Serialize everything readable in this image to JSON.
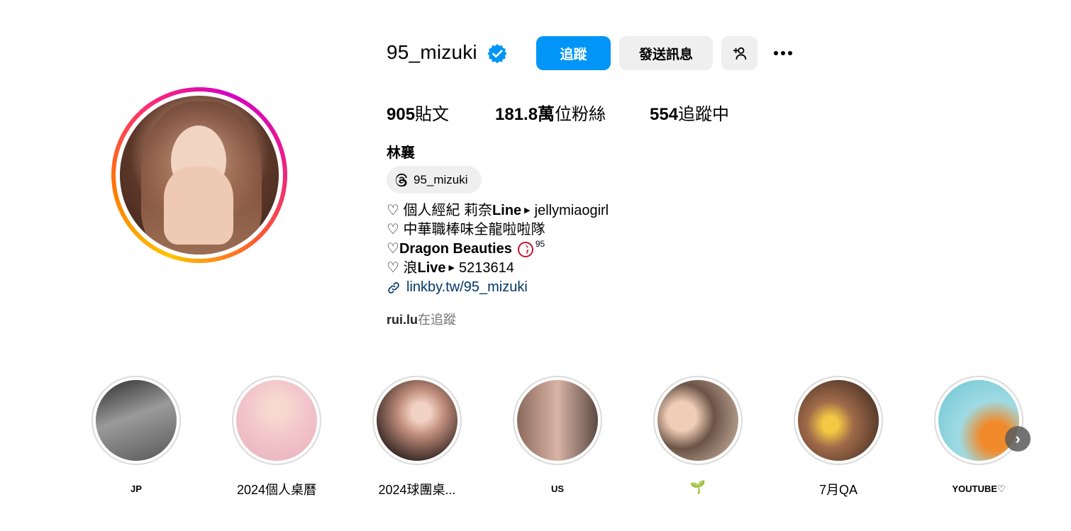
{
  "profile": {
    "username": "95_mizuki",
    "verified_icon": "verified-badge-icon",
    "full_name": "林襄",
    "threads_handle": "95_mizuki"
  },
  "actions": {
    "follow_label": "追蹤",
    "message_label": "發送訊息",
    "suggest_icon": "add-person-icon",
    "more_icon": "more-options-icon"
  },
  "stats": {
    "posts_count": "905",
    "posts_label": "貼文",
    "followers_count": "181.8萬",
    "followers_label": "位粉絲",
    "following_count": "554",
    "following_label": "追蹤中"
  },
  "bio": {
    "line1_prefix": "♡ 個人經紀 莉奈",
    "line1_bold": "Line",
    "line1_value": "jellymiaogirl",
    "line2": "♡ 中華職棒味全龍啦啦隊",
    "line3_prefix": "♡ ",
    "line3_bold": "Dragon Beauties",
    "line3_sup": "95",
    "line4_prefix": "♡ 浪",
    "line4_bold": "Live",
    "line4_value": "5213614",
    "link": "linkby.tw/95_mizuki"
  },
  "followed_by": {
    "user": "rui.lu",
    "suffix": "在追蹤"
  },
  "highlights": [
    {
      "label": "JP",
      "bg": "#6e6e6e"
    },
    {
      "label": "2024個人桌曆",
      "bg": "#f0c9cf"
    },
    {
      "label": "2024球團桌...",
      "bg": "#b97a6c"
    },
    {
      "label": "US",
      "bg": "#7b6056"
    },
    {
      "label": "🌱",
      "bg": "#c9b4a4"
    },
    {
      "label": "7月QA",
      "bg": "#8a5a3a"
    },
    {
      "label": "YOUTUBE♡",
      "bg": "#79c5d2"
    }
  ],
  "colors": {
    "follow_button": "#0095f6",
    "link": "#00376b",
    "verified": "#0095f6"
  }
}
